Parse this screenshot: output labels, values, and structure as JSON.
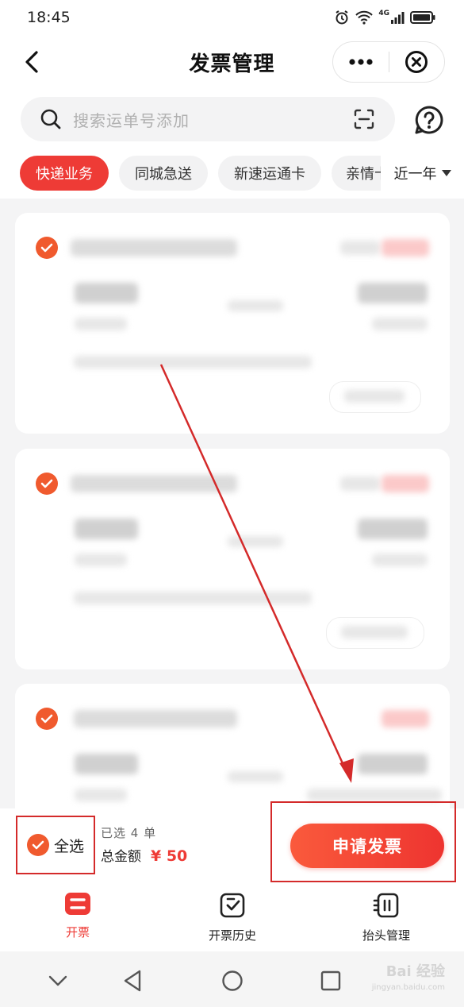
{
  "status_bar": {
    "time": "18:45",
    "network": "4G"
  },
  "nav": {
    "title": "发票管理"
  },
  "search": {
    "placeholder": "搜索运单号添加"
  },
  "tabs": [
    {
      "label": "快递业务",
      "active": true
    },
    {
      "label": "同城急送",
      "active": false
    },
    {
      "label": "新速运通卡",
      "active": false
    },
    {
      "label": "亲情卡",
      "active": false
    }
  ],
  "date_filter": {
    "label": "近一年"
  },
  "bottom": {
    "select_all_label": "全选",
    "selected_count": "已选 4 单",
    "total_label": "总金额",
    "total_amount": "¥ 50",
    "apply_label": "申请发票"
  },
  "tab_bar": {
    "items": [
      {
        "label": "开票",
        "icon": "invoice-icon",
        "active": true
      },
      {
        "label": "开票历史",
        "icon": "history-icon",
        "active": false
      },
      {
        "label": "抬头管理",
        "icon": "header-manage-icon",
        "active": false
      }
    ]
  },
  "watermark": {
    "main": "Bai 经验",
    "sub": "jingyan.baidu.com"
  },
  "colors": {
    "accent": "#ee3b36",
    "check": "#f05a2e",
    "annotation": "#d42a2a"
  }
}
